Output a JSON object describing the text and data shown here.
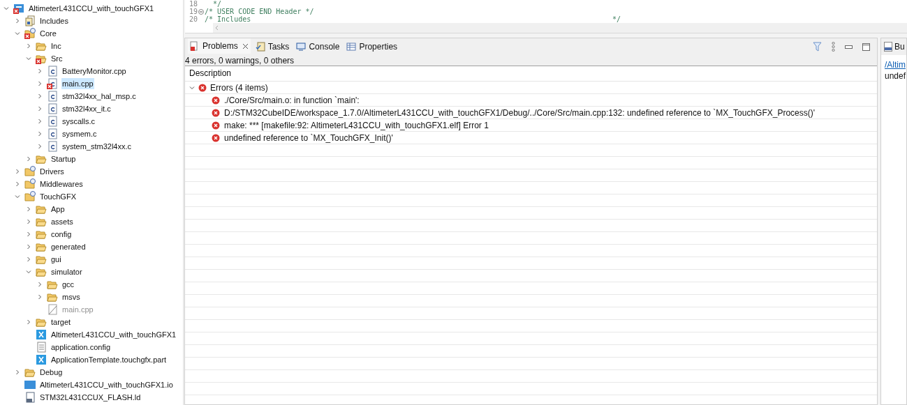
{
  "project_tree": {
    "items": [
      {
        "label": "AltimeterL431CCU_with_touchGFX1",
        "kind": "project",
        "error": true,
        "expanded": true,
        "selected": false,
        "children": [
          {
            "label": "Includes",
            "kind": "includes",
            "error": false,
            "expanded": false,
            "selected": false
          },
          {
            "label": "Core",
            "kind": "source-folder",
            "error": true,
            "expanded": true,
            "selected": false,
            "children": [
              {
                "label": "Inc",
                "kind": "folder",
                "error": false,
                "expanded": false,
                "selected": false
              },
              {
                "label": "Src",
                "kind": "folder",
                "error": true,
                "expanded": true,
                "selected": false,
                "children": [
                  {
                    "label": "BatteryMonitor.cpp",
                    "kind": "c-file",
                    "error": false,
                    "expanded": false,
                    "selected": false
                  },
                  {
                    "label": "main.cpp",
                    "kind": "c-file",
                    "error": true,
                    "expanded": false,
                    "selected": true
                  },
                  {
                    "label": "stm32l4xx_hal_msp.c",
                    "kind": "c-file",
                    "error": false,
                    "expanded": false,
                    "selected": false
                  },
                  {
                    "label": "stm32l4xx_it.c",
                    "kind": "c-file",
                    "error": false,
                    "expanded": false,
                    "selected": false
                  },
                  {
                    "label": "syscalls.c",
                    "kind": "c-file",
                    "error": false,
                    "expanded": false,
                    "selected": false
                  },
                  {
                    "label": "sysmem.c",
                    "kind": "c-file",
                    "error": false,
                    "expanded": false,
                    "selected": false
                  },
                  {
                    "label": "system_stm32l4xx.c",
                    "kind": "c-file",
                    "error": false,
                    "expanded": false,
                    "selected": false
                  }
                ]
              },
              {
                "label": "Startup",
                "kind": "folder",
                "error": false,
                "expanded": false,
                "selected": false
              }
            ]
          },
          {
            "label": "Drivers",
            "kind": "source-folder",
            "error": false,
            "expanded": false,
            "selected": false
          },
          {
            "label": "Middlewares",
            "kind": "source-folder",
            "error": false,
            "expanded": false,
            "selected": false
          },
          {
            "label": "TouchGFX",
            "kind": "source-folder",
            "error": false,
            "expanded": true,
            "selected": false,
            "children": [
              {
                "label": "App",
                "kind": "folder",
                "error": false,
                "expanded": false,
                "selected": false
              },
              {
                "label": "assets",
                "kind": "folder",
                "error": false,
                "expanded": false,
                "selected": false
              },
              {
                "label": "config",
                "kind": "folder",
                "error": false,
                "expanded": false,
                "selected": false
              },
              {
                "label": "generated",
                "kind": "folder",
                "error": false,
                "expanded": false,
                "selected": false
              },
              {
                "label": "gui",
                "kind": "folder",
                "error": false,
                "expanded": false,
                "selected": false
              },
              {
                "label": "simulator",
                "kind": "folder",
                "error": false,
                "expanded": true,
                "selected": false,
                "children": [
                  {
                    "label": "gcc",
                    "kind": "folder",
                    "error": false,
                    "expanded": false,
                    "selected": false
                  },
                  {
                    "label": "msvs",
                    "kind": "folder",
                    "error": false,
                    "expanded": false,
                    "selected": false
                  },
                  {
                    "label": "main.cpp",
                    "kind": "excluded-file",
                    "error": false,
                    "selected": false
                  }
                ]
              },
              {
                "label": "target",
                "kind": "folder",
                "error": false,
                "expanded": false,
                "selected": false
              },
              {
                "label": "AltimeterL431CCU_with_touchGFX1",
                "kind": "x-file",
                "error": false,
                "selected": false
              },
              {
                "label": "application.config",
                "kind": "text-file",
                "error": false,
                "selected": false
              },
              {
                "label": "ApplicationTemplate.touchgfx.part",
                "kind": "x-file",
                "error": false,
                "selected": false
              }
            ]
          },
          {
            "label": "Debug",
            "kind": "folder",
            "error": false,
            "expanded": false,
            "selected": false
          },
          {
            "label": "AltimeterL431CCU_with_touchGFX1.io",
            "kind": "mx-file",
            "error": false,
            "selected": false
          },
          {
            "label": "STM32L431CCUX_FLASH.ld",
            "kind": "ld-file",
            "error": false,
            "selected": false
          }
        ]
      }
    ]
  },
  "editor": {
    "lines": [
      {
        "number": "18",
        "text": "  */",
        "fold": false
      },
      {
        "number": "19",
        "text": "/* USER CODE END Header */",
        "fold": true
      },
      {
        "number": "20",
        "text": "/* Includes",
        "end": "*/",
        "fold": false
      }
    ]
  },
  "problems_view": {
    "tabs": [
      {
        "label": "Problems",
        "kind": "problems",
        "selected": true,
        "closable": true
      },
      {
        "label": "Tasks",
        "kind": "tasks",
        "selected": false,
        "closable": false
      },
      {
        "label": "Console",
        "kind": "console",
        "selected": false,
        "closable": false
      },
      {
        "label": "Properties",
        "kind": "properties",
        "selected": false,
        "closable": false
      }
    ],
    "summary": "4 errors, 0 warnings, 0 others",
    "column": "Description",
    "group": {
      "label": "Errors (4 items)",
      "expanded": true
    },
    "rows": [
      "./Core/Src/main.o: in function `main':",
      "D:/STM32CubeIDE/workspace_1.7.0/AltimeterL431CCU_with_touchGFX1/Debug/../Core/Src/main.cpp:132: undefined reference to `MX_TouchGFX_Process()'",
      "make: *** [makefile:92: AltimeterL431CCU_with_touchGFX1.elf] Error 1",
      "undefined reference to `MX_TouchGFX_Init()'"
    ]
  },
  "side_panel": {
    "tab": "Bu",
    "link": "/Altim",
    "text": "undef"
  }
}
